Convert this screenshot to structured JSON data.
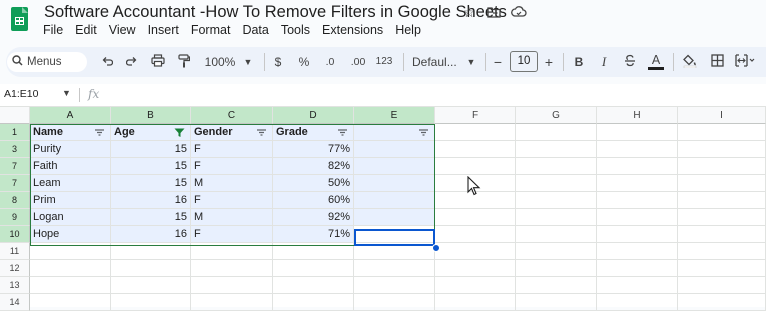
{
  "app": {
    "title": "Software Accountant -How To Remove Filters in Google Sheets",
    "icons": [
      "star-icon",
      "move-to-folder-icon",
      "cloud-status-icon"
    ]
  },
  "menubar": [
    "File",
    "Edit",
    "View",
    "Insert",
    "Format",
    "Data",
    "Tools",
    "Extensions",
    "Help"
  ],
  "toolbar": {
    "search_label": "Menus",
    "zoom": "100%",
    "currency": "$",
    "percent": "%",
    "decrease_decimal": ".0",
    "increase_decimal": ".00",
    "more_formats": "123",
    "font": "Defaul...",
    "font_size": "10",
    "minus": "−",
    "plus": "+",
    "bold": "B",
    "italic": "I",
    "text_color": "A"
  },
  "formula_bar": {
    "name_box": "A1:E10",
    "fx": "fx",
    "value": ""
  },
  "columns": [
    "A",
    "B",
    "C",
    "D",
    "E",
    "F",
    "G",
    "H",
    "I"
  ],
  "rows": [
    {
      "num": "1",
      "cells": [
        "Name",
        "Age",
        "Gender",
        "Grade",
        ""
      ]
    },
    {
      "num": "3",
      "cells": [
        "Purity",
        "15",
        "F",
        "77%",
        ""
      ]
    },
    {
      "num": "7",
      "cells": [
        "Faith",
        "15",
        "F",
        "82%",
        ""
      ]
    },
    {
      "num": "7",
      "cells": [
        "Leam",
        "15",
        "M",
        "50%",
        ""
      ]
    },
    {
      "num": "8",
      "cells": [
        "Prim",
        "16",
        "F",
        "60%",
        ""
      ]
    },
    {
      "num": "9",
      "cells": [
        "Logan",
        "15",
        "M",
        "92%",
        ""
      ]
    },
    {
      "num": "10",
      "cells": [
        "Hope",
        "16",
        "F",
        "71%",
        ""
      ]
    },
    {
      "num": "11",
      "cells": [
        "",
        "",
        "",
        "",
        ""
      ]
    },
    {
      "num": "12",
      "cells": [
        "",
        "",
        "",
        "",
        ""
      ]
    },
    {
      "num": "13",
      "cells": [
        "",
        "",
        "",
        "",
        ""
      ]
    },
    {
      "num": "14",
      "cells": [
        "",
        "",
        "",
        "",
        ""
      ]
    }
  ],
  "colors": {
    "filter_active": "#188038",
    "selection": "#e8f0fe",
    "filtered_header": "#c2e7c9",
    "active_border": "#0b57d0"
  }
}
